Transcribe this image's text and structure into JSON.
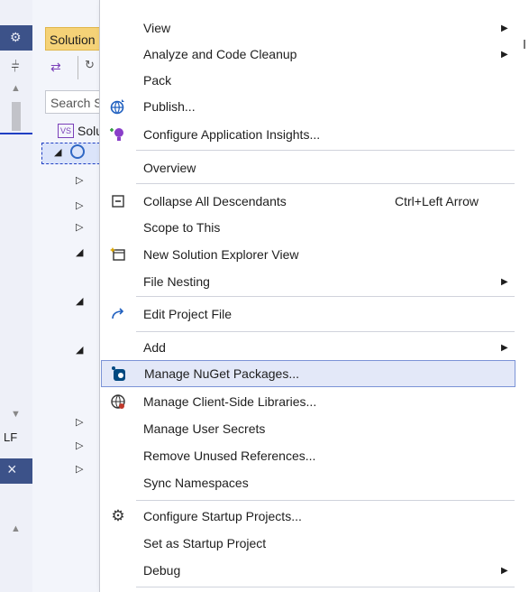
{
  "left_strip": {
    "lf_label": "LF",
    "close_glyph": "×"
  },
  "solution_explorer": {
    "title": "Solution Explorer",
    "search_placeholder": "Search Solution Explorer",
    "root_label": "Solution"
  },
  "context_menu": {
    "items": [
      {
        "label": "View",
        "shortcut": "",
        "submenu": true,
        "icon": ""
      },
      {
        "label": "Analyze and Code Cleanup",
        "shortcut": "",
        "submenu": true,
        "icon": ""
      },
      {
        "label": "Pack",
        "shortcut": "",
        "submenu": false,
        "icon": ""
      },
      {
        "label": "Publish...",
        "shortcut": "",
        "submenu": false,
        "icon": "publish-icon"
      },
      {
        "label": "Configure Application Insights...",
        "shortcut": "",
        "submenu": false,
        "icon": "app-insights-icon"
      },
      {
        "label": "Overview",
        "shortcut": "",
        "submenu": false,
        "icon": ""
      },
      {
        "label": "Collapse All Descendants",
        "shortcut": "Ctrl+Left Arrow",
        "submenu": false,
        "icon": "collapse-all-icon"
      },
      {
        "label": "Scope to This",
        "shortcut": "",
        "submenu": false,
        "icon": ""
      },
      {
        "label": "New Solution Explorer View",
        "shortcut": "",
        "submenu": false,
        "icon": "new-view-icon"
      },
      {
        "label": "File Nesting",
        "shortcut": "",
        "submenu": true,
        "icon": ""
      },
      {
        "label": "Edit Project File",
        "shortcut": "",
        "submenu": false,
        "icon": "edit-redo-icon"
      },
      {
        "label": "Add",
        "shortcut": "",
        "submenu": true,
        "icon": ""
      },
      {
        "label": "Manage NuGet Packages...",
        "shortcut": "",
        "submenu": false,
        "icon": "nuget-icon",
        "highlighted": true
      },
      {
        "label": "Manage Client-Side Libraries...",
        "shortcut": "",
        "submenu": false,
        "icon": "client-libraries-icon"
      },
      {
        "label": "Manage User Secrets",
        "shortcut": "",
        "submenu": false,
        "icon": ""
      },
      {
        "label": "Remove Unused References...",
        "shortcut": "",
        "submenu": false,
        "icon": ""
      },
      {
        "label": "Sync Namespaces",
        "shortcut": "",
        "submenu": false,
        "icon": ""
      },
      {
        "label": "Configure Startup Projects...",
        "shortcut": "",
        "submenu": false,
        "icon": "gear-icon"
      },
      {
        "label": "Set as Startup Project",
        "shortcut": "",
        "submenu": false,
        "icon": ""
      },
      {
        "label": "Debug",
        "shortcut": "",
        "submenu": true,
        "icon": ""
      }
    ]
  },
  "colors": {
    "highlight_bg": "#e3e8f8",
    "highlight_border": "#7b93d6",
    "title_tab": "#f5d277",
    "panel_header": "#3c5289"
  }
}
